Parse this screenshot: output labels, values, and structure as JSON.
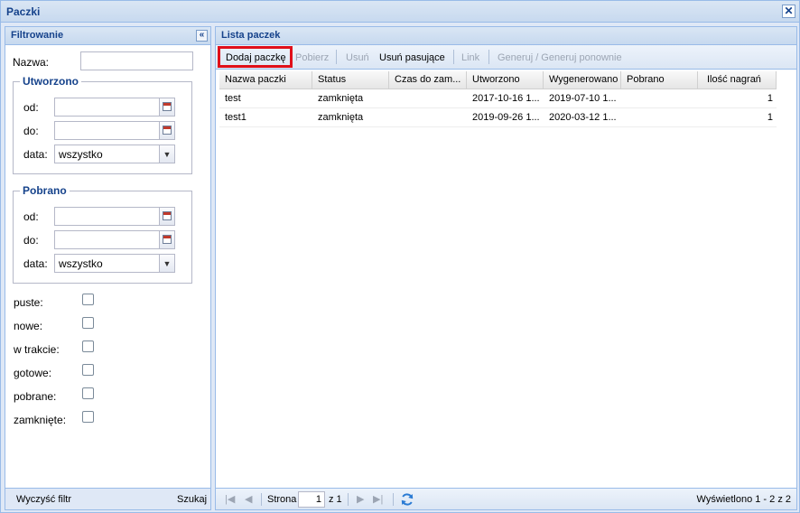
{
  "window": {
    "title": "Paczki"
  },
  "filter_panel": {
    "title": "Filtrowanie",
    "name_label": "Nazwa:",
    "name_value": "",
    "created": {
      "legend": "Utworzono",
      "from_label": "od:",
      "to_label": "do:",
      "date_label": "data:",
      "date_value": "wszystko"
    },
    "downloaded": {
      "legend": "Pobrano",
      "from_label": "od:",
      "to_label": "do:",
      "date_label": "data:",
      "date_value": "wszystko"
    },
    "checkboxes": [
      {
        "label": "puste:",
        "checked": false
      },
      {
        "label": "nowe:",
        "checked": false
      },
      {
        "label": "w trakcie:",
        "checked": false
      },
      {
        "label": "gotowe:",
        "checked": false
      },
      {
        "label": "pobrane:",
        "checked": false
      },
      {
        "label": "zamknięte:",
        "checked": false
      }
    ],
    "footer": {
      "clear_label": "Wyczyść filtr",
      "search_label": "Szukaj"
    }
  },
  "list_panel": {
    "title": "Lista paczek",
    "toolbar": {
      "add": "Dodaj paczkę",
      "fetch": "Pobierz",
      "delete": "Usuń",
      "delete_matching": "Usuń pasujące",
      "link": "Link",
      "generate": "Generuj / Generuj ponownie"
    },
    "columns": [
      "Nazwa paczki",
      "Status",
      "Czas do zam...",
      "Utworzono",
      "Wygenerowano",
      "Pobrano",
      "Ilość nagrań"
    ],
    "rows": [
      {
        "name": "test",
        "status": "zamknięta",
        "time_to_close": "",
        "created": "2017-10-16 1...",
        "generated": "2019-07-10 1...",
        "downloaded": "",
        "recordings": "1"
      },
      {
        "name": "test1",
        "status": "zamknięta",
        "time_to_close": "",
        "created": "2019-09-26 1...",
        "generated": "2020-03-12 1...",
        "downloaded": "",
        "recordings": "1"
      }
    ],
    "pager": {
      "page_label": "Strona",
      "page_value": "1",
      "of_label": "z 1",
      "status": "Wyświetlono 1 - 2 z 2"
    }
  },
  "colors": {
    "header_text": "#15428b",
    "highlight": "#e0101a",
    "border": "#99bbe8"
  },
  "icons": [
    "close-icon",
    "collapse-left-icon",
    "calendar-icon",
    "dropdown-arrow-icon",
    "first-page-icon",
    "prev-page-icon",
    "next-page-icon",
    "last-page-icon",
    "refresh-icon"
  ]
}
